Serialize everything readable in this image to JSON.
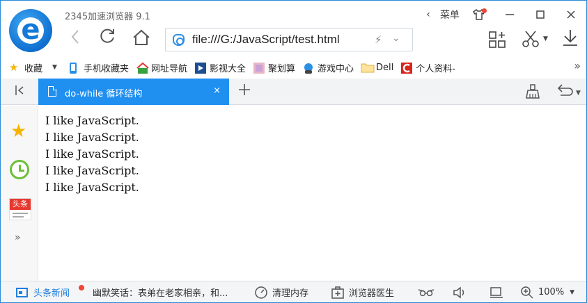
{
  "app": {
    "title": "2345加速浏览器 9.1"
  },
  "window": {
    "menu_label": "菜单",
    "menu_arrow_icon": "chevron-left-icon",
    "minimize_icon": "minimize-icon",
    "maximize_icon": "maximize-icon",
    "close_icon": "close-icon"
  },
  "nav": {
    "address_url": "file:///G:/JavaScript/test.html"
  },
  "bookmarks": [
    {
      "label": "收藏",
      "icon": "star-icon"
    },
    {
      "label": "手机收藏夹",
      "icon": "phone-icon"
    },
    {
      "label": "网址导航",
      "icon": "house-2345-icon"
    },
    {
      "label": "影视大全",
      "icon": "film-icon"
    },
    {
      "label": "聚划算",
      "icon": "juhuasuan-icon"
    },
    {
      "label": "游戏中心",
      "icon": "game-icon"
    },
    {
      "label": "Dell",
      "icon": "folder-icon"
    },
    {
      "label": "个人资料-",
      "icon": "c-red-icon"
    }
  ],
  "tab": {
    "title": "do-while 循环结构",
    "close": "×"
  },
  "page": {
    "lines": [
      "I like JavaScript.",
      "I like JavaScript.",
      "I like JavaScript.",
      "I like JavaScript.",
      "I like JavaScript."
    ]
  },
  "sidebar": {
    "news_label": "头条",
    "more": "»"
  },
  "status": {
    "news_label": "头条新闻",
    "headline": "幽默笑话：表弟在老家相亲，和...",
    "clean_memory": "清理内存",
    "doctor": "浏览器医生",
    "zoom": "100%",
    "colors": {
      "accent": "#1f8ff0",
      "badge": "#f04438"
    }
  }
}
